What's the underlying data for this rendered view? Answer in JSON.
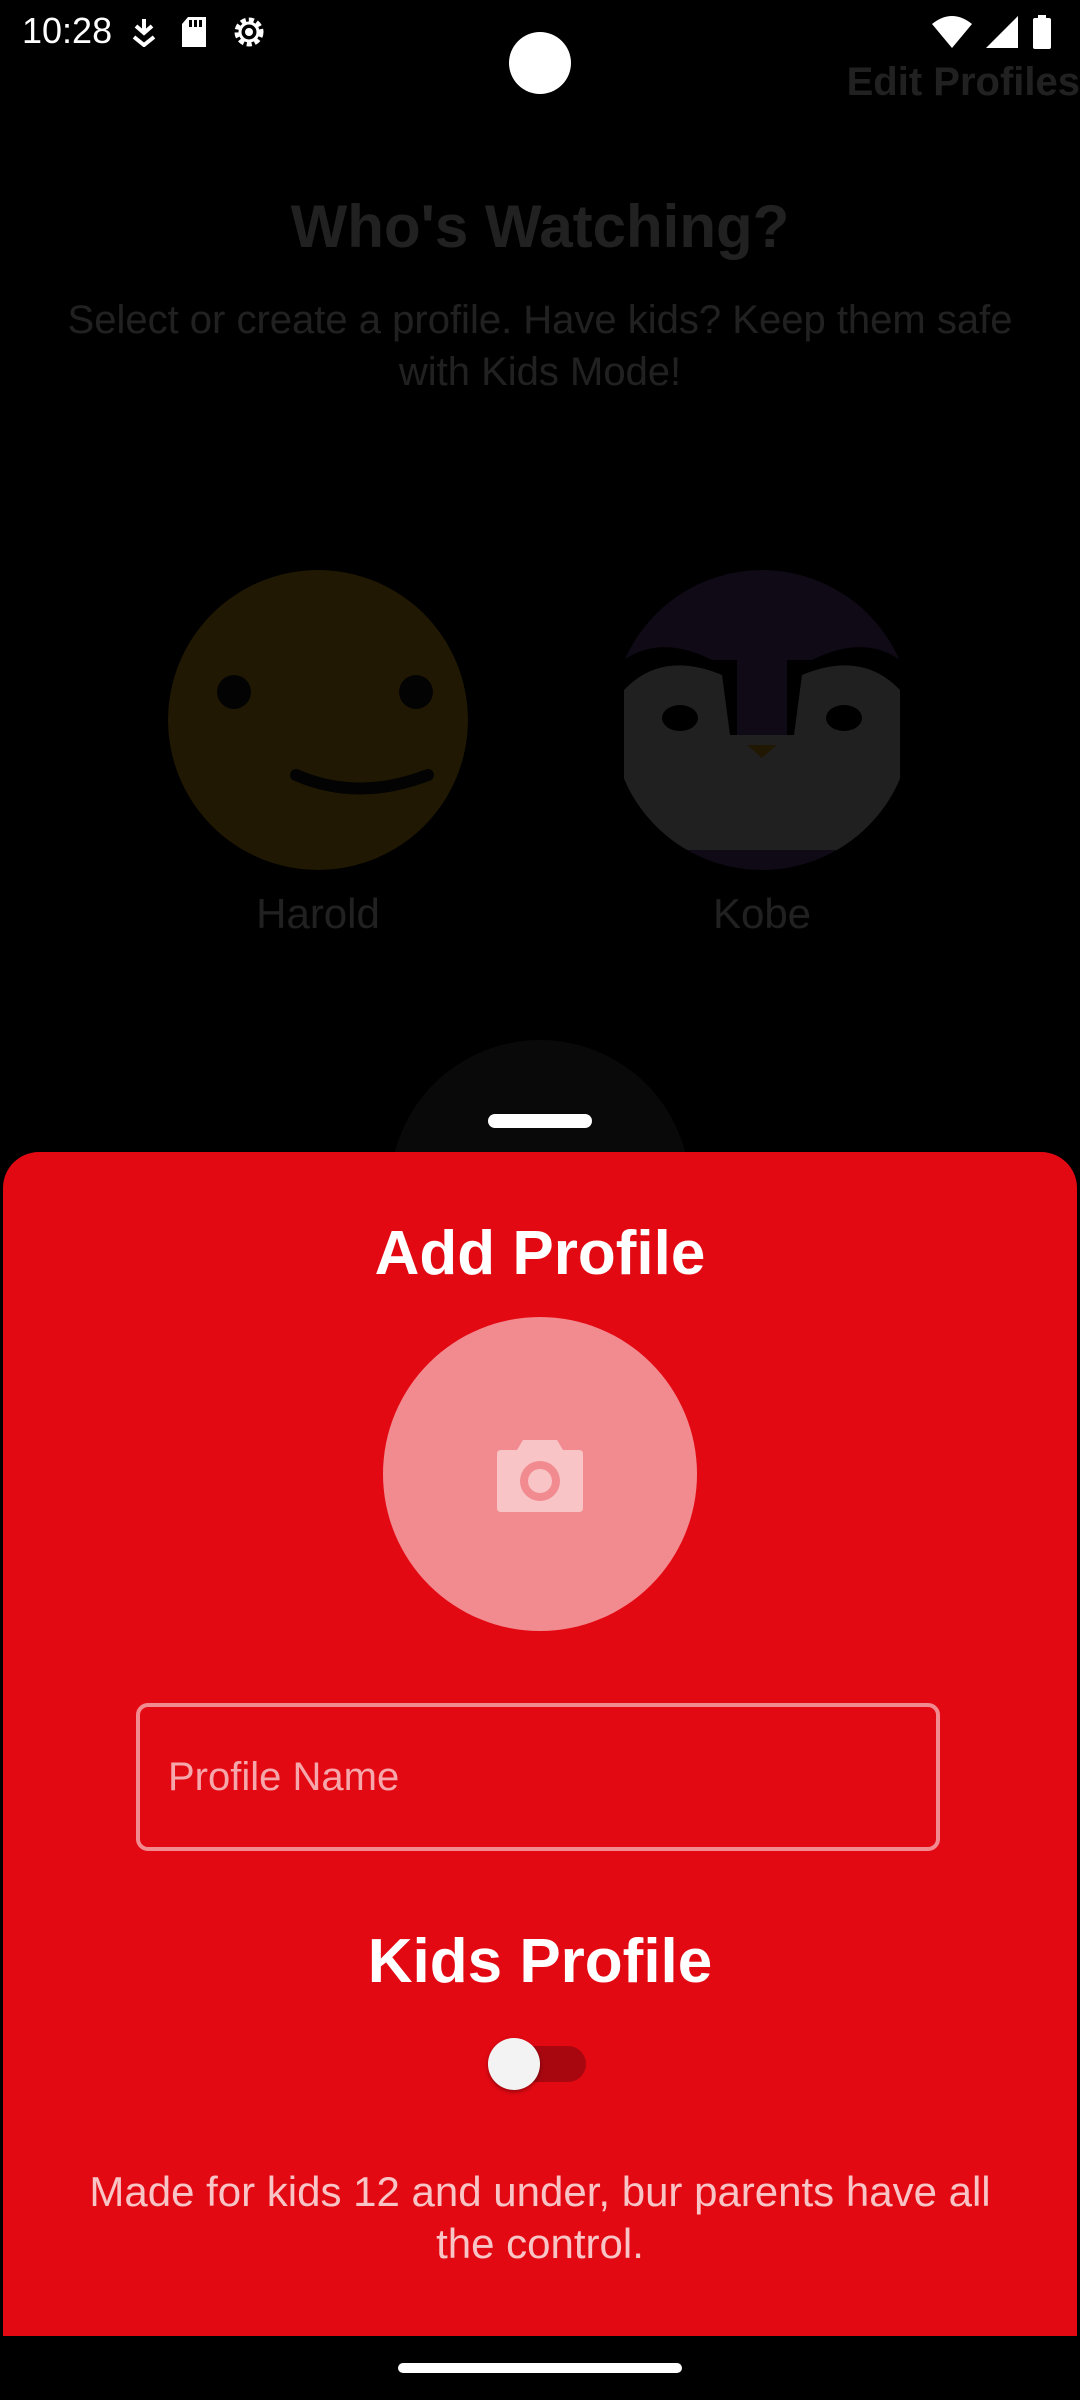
{
  "status_bar": {
    "time": "10:28",
    "left_icons": [
      "download-icon",
      "sd-card-icon",
      "settings-gear-icon"
    ],
    "right_icons": [
      "wifi-icon",
      "cell-signal-icon",
      "battery-icon"
    ]
  },
  "background": {
    "edit_profiles_label": "Edit Profiles",
    "title": "Who's Watching?",
    "subtitle": "Select or create a profile. Have kids? Keep them safe with Kids Mode!",
    "profiles": [
      {
        "name": "Harold",
        "avatar": "smiley-face-avatar",
        "color": "#f3b814"
      },
      {
        "name": "Kobe",
        "avatar": "penguin-avatar",
        "color": "#7a4aa8"
      }
    ]
  },
  "sheet": {
    "title": "Add Profile",
    "photo_icon": "camera-icon",
    "name_field": {
      "placeholder": "Profile Name",
      "value": ""
    },
    "kids_title": "Kids Profile",
    "kids_toggle_on": false,
    "kids_description": "Made for kids 12 and under, bur parents have all the control."
  },
  "colors": {
    "accent": "#e30913",
    "photo_circle": "#f28b90",
    "background": "#000000"
  }
}
